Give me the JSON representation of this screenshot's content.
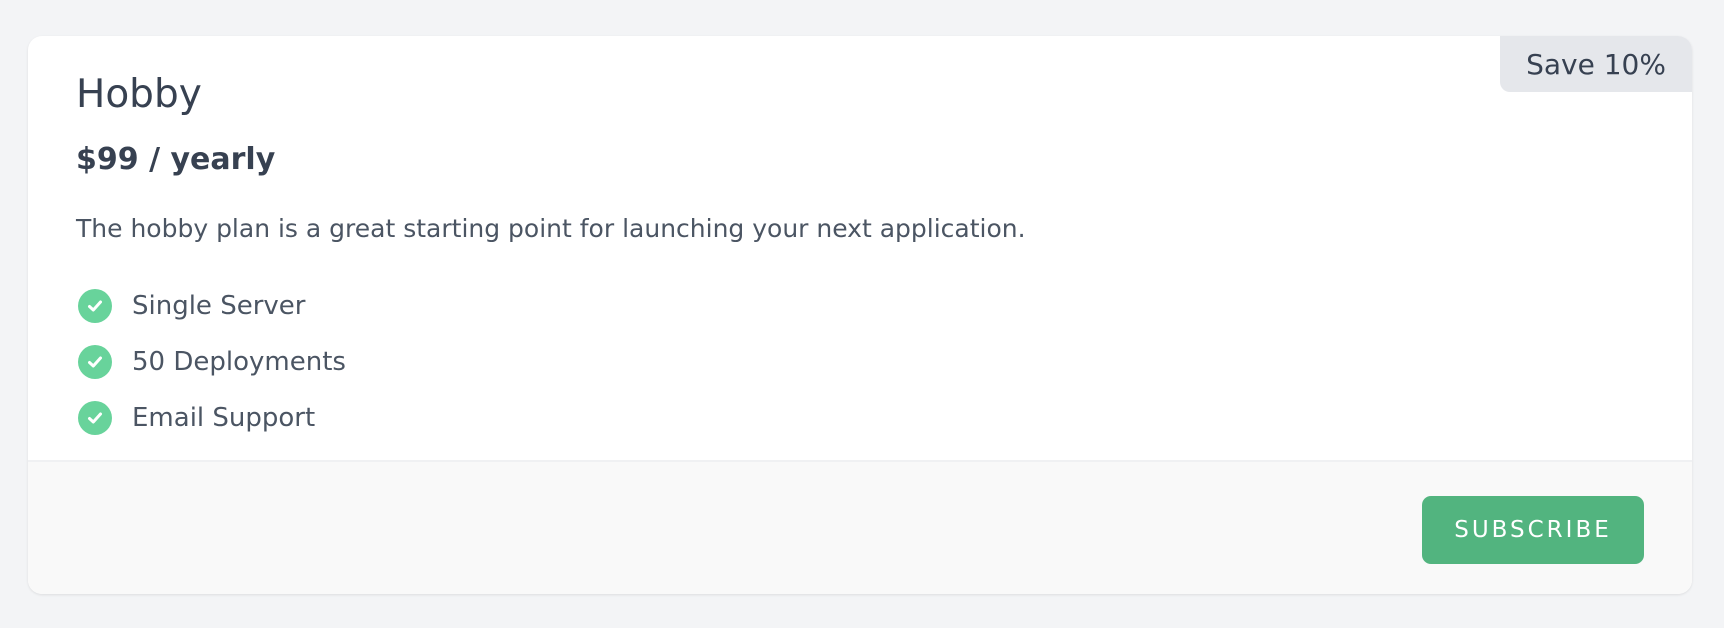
{
  "plan": {
    "badge": "Save 10%",
    "title": "Hobby",
    "price": "$99 / yearly",
    "description": "The hobby plan is a great starting point for launching your next application.",
    "features": [
      {
        "icon": "check-circle-icon",
        "label": "Single Server"
      },
      {
        "icon": "check-circle-icon",
        "label": "50 Deployments"
      },
      {
        "icon": "check-circle-icon",
        "label": "Email Support"
      }
    ]
  },
  "footer": {
    "subscribe_label": "SUBSCRIBE"
  },
  "colors": {
    "background": "#f3f4f6",
    "card": "#ffffff",
    "badge": "#e5e7eb",
    "check": "#68d39b",
    "button": "#52b47f",
    "text": "#374151"
  }
}
